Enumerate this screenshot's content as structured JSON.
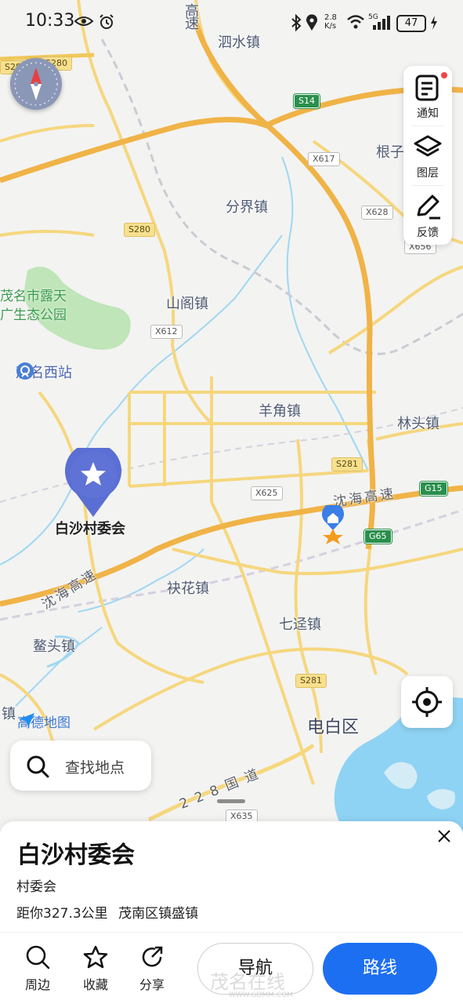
{
  "status_bar": {
    "time": "10:33",
    "net_speed_value": "2.8",
    "net_speed_unit": "K/s",
    "battery": "47",
    "signal": "5G"
  },
  "map": {
    "towns": {
      "sishui": "泗水镇",
      "genzi": "根子",
      "fenjie": "分界镇",
      "shange": "山阁镇",
      "yangjiao": "羊角镇",
      "lintou": "林头镇",
      "jiuhua": "袂花镇",
      "qijing": "七迳镇",
      "aotou": "鳌头镇",
      "zhen_edge": "镇",
      "dianbai": "电白区",
      "gaosu_top": "高",
      "gaosu_top2": "速"
    },
    "park": {
      "line1": "茂名市露天",
      "line2": "广生态公园"
    },
    "station": "茂名西站",
    "selected_place_label": "白沙村委会",
    "road_names": {
      "shenhai_east": "沈海高速",
      "shenhai_west": "沈海高速",
      "g228": "228国道"
    },
    "shields": {
      "s280_a": "S280",
      "s280_b": "S280",
      "s280_c": "S280",
      "s14": "S14",
      "x617": "X617",
      "x628": "X628",
      "x656": "X656",
      "x612": "X612",
      "x625": "X625",
      "s281_a": "S281",
      "s281_b": "S281",
      "g15": "G15",
      "g65": "G65",
      "x635": "X635"
    },
    "brand": "高德地图"
  },
  "toolbar": {
    "notify": "通知",
    "layers": "图层",
    "feedback": "反馈"
  },
  "search": {
    "placeholder": "查找地点"
  },
  "place_card": {
    "name": "白沙村委会",
    "type": "村委会",
    "distance": "距你327.3公里",
    "address": "茂南区镇盛镇"
  },
  "actions": {
    "nearby": "周边",
    "favorite": "收藏",
    "share": "分享",
    "navigate": "导航",
    "route": "路线"
  },
  "watermark": {
    "text": "茂名在线",
    "url": "WWW.GDMM.COM"
  },
  "colors": {
    "primary": "#1d6ff2",
    "water": "#8fd3f4",
    "highway": "#f0b347",
    "park": "#bfe5b9"
  }
}
